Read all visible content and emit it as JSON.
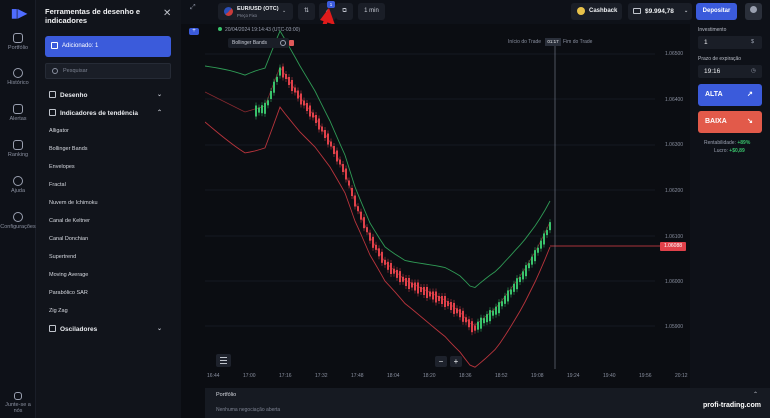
{
  "rail": {
    "items": [
      {
        "label": "Portfólio",
        "icon": "briefcase-icon"
      },
      {
        "label": "Histórico",
        "icon": "history-icon"
      },
      {
        "label": "Alertas",
        "icon": "bell-icon"
      },
      {
        "label": "Ranking",
        "icon": "trophy-icon"
      },
      {
        "label": "Ajuda",
        "icon": "help-icon"
      },
      {
        "label": "Configurações",
        "icon": "settings-icon"
      }
    ],
    "bottom_label": "Junte-se a nós"
  },
  "panel": {
    "title": "Ferramentas de desenho e indicadores",
    "added_label": "Adicionado: 1",
    "search_placeholder": "Pesquisar",
    "section_drawing": "Desenho",
    "section_trend": "Indicadores de tendência",
    "indicators": [
      "Alligator",
      "Bollinger Bands",
      "Envelopes",
      "Fractal",
      "Nuvem de Ichimoku",
      "Canal de Keltner",
      "Canal Donchian",
      "Supertrend",
      "Moving Average",
      "Parabólico SAR",
      "Zig Zag"
    ],
    "section_oscillators": "Osciladores"
  },
  "topbar": {
    "asset_name": "EUR/USD (OTC)",
    "asset_sub": "Preço Fixo",
    "badge_count": "1",
    "timeframe": "1 min",
    "cashback": "Cashback",
    "balance": "$9.994,78",
    "deposit": "Depositar"
  },
  "chart": {
    "datetime": "20/04/2024 19:14:43 (UTC-03:00)",
    "indicator_tag": "Bollinger Bands",
    "trade_start": "Início do Trade",
    "countdown": "01:17",
    "trade_end": "Fim do Trade",
    "price_labels": [
      "1.06500",
      "1.06400",
      "1.06300",
      "1.06200",
      "1.06100",
      "1.06000",
      "1.05900"
    ],
    "current_price": "1.06088",
    "time_labels": [
      "16:44",
      "17:00",
      "17:16",
      "17:32",
      "17:48",
      "18:04",
      "18:20",
      "18:36",
      "18:52",
      "19:08",
      "19:24",
      "19:40",
      "19:56",
      "20:12"
    ],
    "colors": {
      "bull": "#39c26b",
      "bear": "#e0414a",
      "upper_band": "#2f9a55",
      "lower_band": "#b8343c"
    }
  },
  "portfolio": {
    "title": "Portfólio",
    "empty_text": "Nenhuma negociação aberta"
  },
  "trade": {
    "invest_label": "Investimento",
    "invest_value": "1",
    "expiry_label": "Prazo de expiração",
    "expiry_value": "19:16",
    "up_label": "ALTA",
    "down_label": "BAIXA",
    "rent_label": "Rentabilidade:",
    "rent_value": "+89%",
    "profit_label": "Lucro:",
    "profit_value": "+$0,89"
  },
  "watermark": "profi-trading.com"
}
